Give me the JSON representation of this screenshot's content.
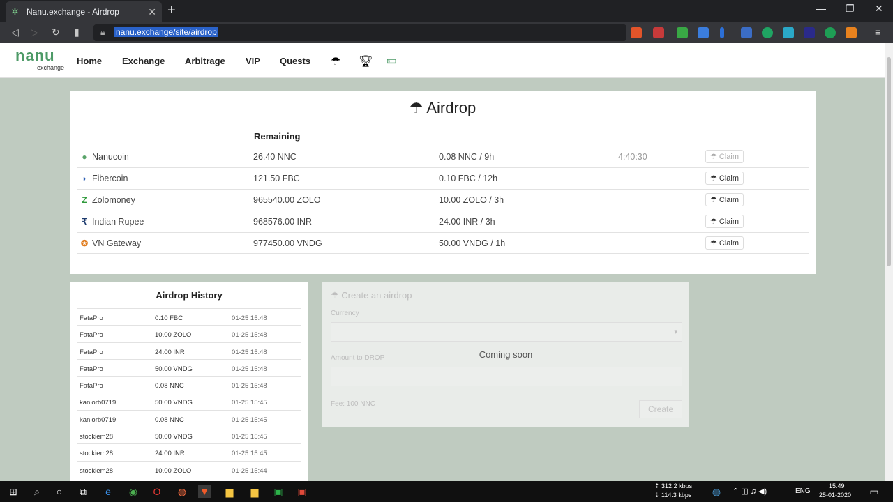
{
  "browser": {
    "tab_title": "Nanu.exchange - Airdrop",
    "tab_close": "✕",
    "new_tab": "+",
    "url": "nanu.exchange/site/airdrop",
    "minimize": "—",
    "maximize": "❐",
    "close": "✕"
  },
  "site": {
    "logo_top": "nanu",
    "logo_bottom": "exchange",
    "nav": [
      "Home",
      "Exchange",
      "Arbitrage",
      "VIP",
      "Quests"
    ]
  },
  "airdrop": {
    "title": "Airdrop",
    "remaining_header": "Remaining",
    "claim_label": "Claim",
    "rows": [
      {
        "name": "Nanucoin",
        "remaining": "26.40 NNC",
        "rate": "0.08 NNC / 9h",
        "timer": "4:40:30",
        "icon_color": "#5aa46a",
        "icon_char": "●",
        "claim_disabled": true
      },
      {
        "name": "Fibercoin",
        "remaining": "121.50 FBC",
        "rate": "0.10 FBC / 12h",
        "timer": "",
        "icon_color": "#2d5fb5",
        "icon_char": "◗",
        "claim_disabled": false
      },
      {
        "name": "Zolomoney",
        "remaining": "965540.00 ZOLO",
        "rate": "10.00 ZOLO / 3h",
        "timer": "",
        "icon_color": "#2f9a3b",
        "icon_char": "Z",
        "claim_disabled": false
      },
      {
        "name": "Indian Rupee",
        "remaining": "968576.00 INR",
        "rate": "24.00 INR / 3h",
        "timer": "",
        "icon_color": "#1d3b6e",
        "icon_char": "₹",
        "claim_disabled": false
      },
      {
        "name": "VN Gateway",
        "remaining": "977450.00 VNDG",
        "rate": "50.00 VNDG / 1h",
        "timer": "",
        "icon_color": "#e07a1a",
        "icon_char": "✪",
        "claim_disabled": false
      }
    ]
  },
  "history": {
    "title": "Airdrop History",
    "rows": [
      {
        "user": "FataPro",
        "amount": "0.10 FBC",
        "time": "01-25 15:48"
      },
      {
        "user": "FataPro",
        "amount": "10.00 ZOLO",
        "time": "01-25 15:48"
      },
      {
        "user": "FataPro",
        "amount": "24.00 INR",
        "time": "01-25 15:48"
      },
      {
        "user": "FataPro",
        "amount": "50.00 VNDG",
        "time": "01-25 15:48"
      },
      {
        "user": "FataPro",
        "amount": "0.08 NNC",
        "time": "01-25 15:48"
      },
      {
        "user": "kanlorb0719",
        "amount": "50.00 VNDG",
        "time": "01-25 15:45"
      },
      {
        "user": "kanlorb0719",
        "amount": "0.08 NNC",
        "time": "01-25 15:45"
      },
      {
        "user": "stockiem28",
        "amount": "50.00 VNDG",
        "time": "01-25 15:45"
      },
      {
        "user": "stockiem28",
        "amount": "24.00 INR",
        "time": "01-25 15:45"
      },
      {
        "user": "stockiem28",
        "amount": "10.00 ZOLO",
        "time": "01-25 15:44"
      }
    ]
  },
  "create": {
    "title": "Create an airdrop",
    "currency_label": "Currency",
    "amount_label": "Amount to DROP",
    "fee_label": "Fee: 100 NNC",
    "coming_soon": "Coming soon",
    "button": "Create"
  },
  "taskbar": {
    "net_up": "312.2 kbps",
    "net_down": "114.3 kbps",
    "lang": "ENG",
    "time": "15:49",
    "date": "25-01-2020"
  }
}
